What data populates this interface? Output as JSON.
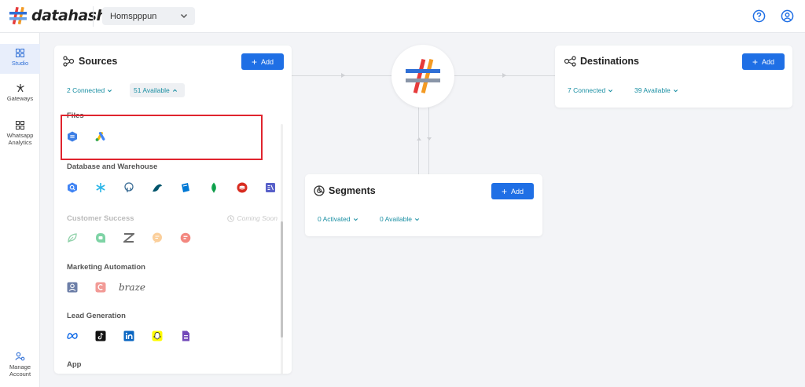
{
  "header": {
    "logo_text": "datahash",
    "workspace": "Homspppun",
    "help_icon": "help-circle-icon",
    "account_icon": "user-circle-icon"
  },
  "sidebar": {
    "items": [
      {
        "label": "Studio",
        "icon": "grid-icon",
        "active": true
      },
      {
        "label": "Gateways",
        "icon": "network-icon",
        "active": false
      },
      {
        "label": "Whatsapp Analytics",
        "icon": "grid-icon",
        "active": false
      },
      {
        "label": "Manage Account",
        "icon": "users-gear-icon",
        "active": false
      }
    ]
  },
  "sources": {
    "title": "Sources",
    "add_label": "Add",
    "connected": "2 Connected",
    "available": "51 Available",
    "sections": [
      {
        "label": "Files",
        "icons": [
          "file-hex-icon",
          "google-ads-icon"
        ]
      },
      {
        "label": "Database and Warehouse",
        "icons": [
          "bigquery-icon",
          "snowflake-icon",
          "postgresql-icon",
          "mysql-icon",
          "azure-icon",
          "mongodb-icon",
          "redis-icon",
          "database-icon"
        ]
      },
      {
        "label": "Customer Success",
        "coming_soon": "Coming Soon",
        "icons": [
          "leaf-icon",
          "freshdesk-icon",
          "zendesk-icon",
          "chat-icon",
          "freshchat-icon"
        ]
      },
      {
        "label": "Marketing Automation",
        "icons": [
          "person-icon",
          "c-icon"
        ],
        "wordmark": "braze"
      },
      {
        "label": "Lead Generation",
        "icons": [
          "meta-icon",
          "tiktok-icon",
          "linkedin-icon",
          "snapchat-icon",
          "forms-icon"
        ]
      },
      {
        "label": "App",
        "icons": []
      }
    ]
  },
  "destinations": {
    "title": "Destinations",
    "add_label": "Add",
    "connected": "7 Connected",
    "available": "39 Available"
  },
  "segments": {
    "title": "Segments",
    "add_label": "Add",
    "activated": "0 Activated",
    "available": "0 Available"
  },
  "colors": {
    "accent": "#1f6fe5",
    "teal": "#1a8fa3",
    "highlight": "#e0242e"
  }
}
